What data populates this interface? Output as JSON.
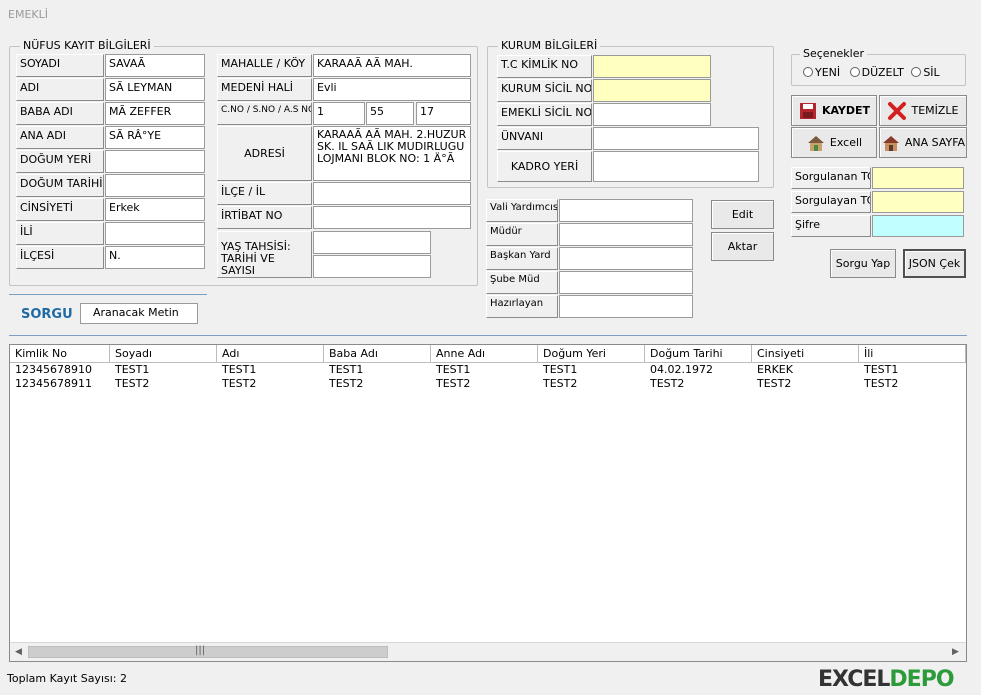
{
  "window": {
    "title": "EMEKLİ"
  },
  "nufus": {
    "title": "NÜFUS KAYIT BİLGİLERİ",
    "fields": [
      {
        "label": "SOYADI",
        "value": "SAVAÃ"
      },
      {
        "label": "ADI",
        "value": "SÃ   LEYMAN"
      },
      {
        "label": "BABA ADI",
        "value": "MÃ   ZEFFER"
      },
      {
        "label": "ANA ADI",
        "value": "SÃ   RÂ°YE"
      },
      {
        "label": "DOĞUM YERİ",
        "value": ""
      },
      {
        "label": "DOĞUM TARİHİ",
        "value": ""
      },
      {
        "label": "CİNSİYETİ",
        "value": "Erkek"
      },
      {
        "label": "İLİ",
        "value": ""
      },
      {
        "label": "İLÇESİ",
        "value": "N."
      }
    ],
    "mahalle_label": "MAHALLE / KÖY",
    "mahalle_value": "KARAAÃ   AÃ   MAH.",
    "medeni_label": "MEDENİ HALİ",
    "medeni_value": "Evli",
    "cno_label": "C.NO / S.NO / A.S NO",
    "cno_values": [
      "1",
      "55",
      "17"
    ],
    "adres_label": "ADRESİ",
    "adres_value": "KARAAÃ   AÃ   MAH. 2.HUZUR SK. IL SAÃ   LIK MUDIRLUGU LOJMANI BLOK  NO: 1  Ä°Ã",
    "ilce_label": "İLÇE / İL",
    "ilce_value": "",
    "irtibat_label": "İRTİBAT NO",
    "irtibat_value": "",
    "yas_label": "YAŞ TAHSİSİ: TARİHİ VE SAYISI",
    "yas_values": [
      "",
      ""
    ]
  },
  "kurum": {
    "title": "KURUM BİLGİLERİ",
    "fields": [
      {
        "label": "T.C KİMLİK  NO",
        "value": ""
      },
      {
        "label": "KURUM SİCİL NO",
        "value": ""
      },
      {
        "label": "EMEKLİ SİCİL NO",
        "value": ""
      },
      {
        "label": "ÜNVANI",
        "value": ""
      },
      {
        "label": "KADRO YERİ",
        "value": ""
      }
    ],
    "signers": [
      {
        "label": "Vali Yardımcısı",
        "value": ""
      },
      {
        "label": "Müdür",
        "value": ""
      },
      {
        "label": "Başkan Yard",
        "value": ""
      },
      {
        "label": "Şube Müd",
        "value": ""
      },
      {
        "label": "Hazırlayan",
        "value": ""
      }
    ],
    "edit_label": "Edit",
    "aktar_label": "Aktar"
  },
  "options": {
    "title": "Seçenekler",
    "radios": [
      "YENİ",
      "DÜZELT",
      "SİL"
    ]
  },
  "actions": {
    "kaydet": "KAYDET",
    "temizle": "TEMİZLE",
    "excell": "Excell",
    "ana_sayfa": "ANA SAYFA"
  },
  "query": {
    "sorgulanan_label": "Sorgulanan TC",
    "sorgulanan_value": "",
    "sorgulayan_label": "Sorgulayan TC",
    "sorgulayan_value": "",
    "sifre_label": "Şifre",
    "sifre_value": "",
    "sorgu_yap": "Sorgu Yap",
    "json_cek": "JSON Çek"
  },
  "search": {
    "title": "SORGU",
    "placeholder": "Aranacak Metin"
  },
  "table": {
    "columns": [
      "Kimlik No",
      "Soyadı",
      "Adı",
      "Baba Adı",
      "Anne Adı",
      "Doğum Yeri",
      "Doğum Tarihi",
      "Cinsiyeti",
      "İli"
    ],
    "rows": [
      [
        "12345678910",
        "TEST1",
        "TEST1",
        "TEST1",
        "TEST1",
        "TEST1",
        "04.02.1972",
        "ERKEK",
        "TEST1"
      ],
      [
        "12345678911",
        "TEST2",
        "TEST2",
        "TEST2",
        "TEST2",
        "TEST2",
        "TEST2",
        "TEST2",
        "TEST2"
      ]
    ]
  },
  "status": {
    "text": "Toplam Kayıt Sayısı: 2"
  },
  "watermark": {
    "text1": "EXCEL",
    "text2": "DEPO"
  },
  "colors": {
    "yellow": "#ffffc0",
    "cyan": "#c0ffff",
    "accent": "#1f6aa5"
  }
}
